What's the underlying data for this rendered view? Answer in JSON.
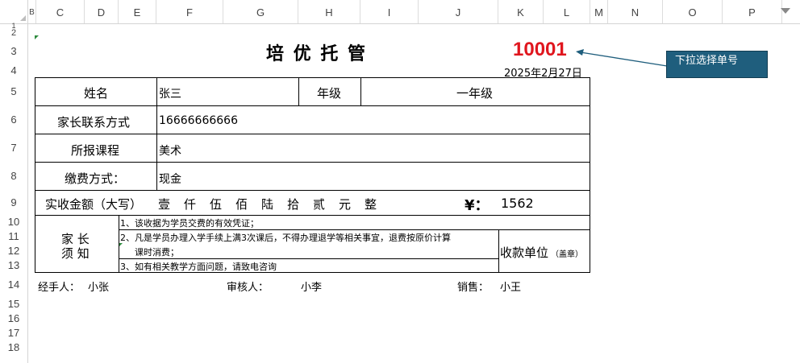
{
  "column_headers": [
    "B",
    "C",
    "D",
    "E",
    "F",
    "G",
    "H",
    "I",
    "J",
    "K",
    "L",
    "M",
    "N",
    "O",
    "P"
  ],
  "row_headers": [
    "1",
    "2",
    "3",
    "4",
    "5",
    "6",
    "7",
    "8",
    "9",
    "10",
    "11",
    "12",
    "13",
    "14",
    "15",
    "16",
    "17",
    "18"
  ],
  "receipt": {
    "title": "培 优 托 管",
    "number": "10001",
    "date": "2025年2月27日",
    "name_label": "姓名",
    "name_value": "张三",
    "grade_label": "年级",
    "grade_value": "一年级",
    "contact_label": "家长联系方式",
    "contact_value": "16666666666",
    "course_label": "所报课程",
    "course_value": "美术",
    "payment_label": "缴费方式：",
    "payment_value": "现金",
    "amount_label": "实收金额（大写）",
    "amount_words": "壹　仟　伍　佰　陆　拾　贰　元　整",
    "currency_symbol": "¥：",
    "amount_value": "1562",
    "notice_label_1": "家 长",
    "notice_label_2": "须 知",
    "notice_1": "1、该收据为学员交费的有效凭证；",
    "notice_2a": "2、凡是学员办理入学手续上满3次课后，不得办理退学等相关事宜，退费按原价计算",
    "notice_2b": "课时消费；",
    "notice_3": "3、如有相关教学方面问题，请致电咨询",
    "receiver_label": "收款单位",
    "receiver_stamp": "（盖章）",
    "handler_label": "经手人：",
    "handler_value": "小张",
    "reviewer_label": "审核人：",
    "reviewer_value": "小李",
    "sales_label": "销售：",
    "sales_value": "小王"
  },
  "callout_text": "下拉选择单号",
  "colors": {
    "number_red": "#e0161e",
    "callout_bg": "#1f5e7d",
    "arrow": "#1f5e7d"
  }
}
